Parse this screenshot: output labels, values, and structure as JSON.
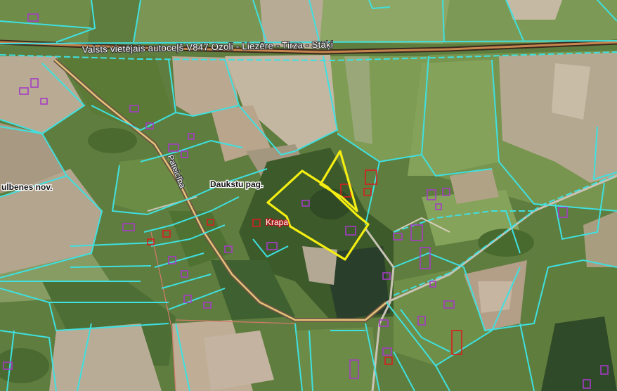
{
  "labels": {
    "road": "Valsts vietējais autoceļš V847 Ozoli - Liezēre - Tirza - Stāķi",
    "street": "Pateicība",
    "parish": "Daukstu pag.",
    "municipality": "ulbenes nov.",
    "place": "Krapa"
  },
  "colors": {
    "parcel_boundary": "#3fe0e0",
    "highlight_parcel": "#f5ee12",
    "building_outline": "#9b2fb8",
    "building_red": "#d62020",
    "road_main": "#d79a52",
    "road_secondary": "#e8d7a0"
  }
}
